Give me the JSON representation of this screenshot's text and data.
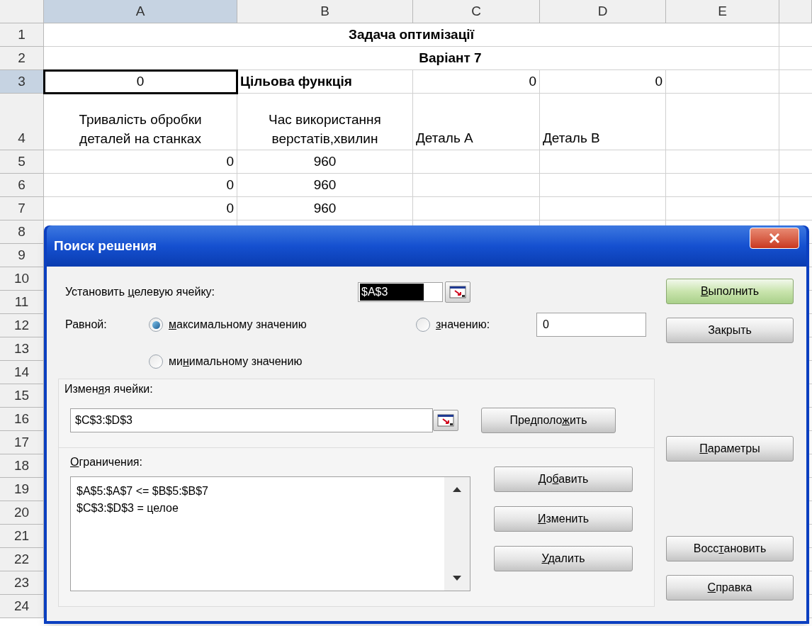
{
  "sheet": {
    "columns": [
      {
        "label": "A",
        "selected": true
      },
      {
        "label": "B",
        "selected": false
      },
      {
        "label": "C",
        "selected": false
      },
      {
        "label": "D",
        "selected": false
      },
      {
        "label": "E",
        "selected": false
      }
    ],
    "rows": [
      {
        "number": "1",
        "selected": false,
        "kind": "title",
        "text": "Задача оптимізації"
      },
      {
        "number": "2",
        "selected": false,
        "kind": "title",
        "text": "Варіант 7"
      },
      {
        "number": "3",
        "selected": true,
        "kind": "cells",
        "cells": [
          {
            "kind": "centered",
            "text": "0",
            "selected": true
          },
          {
            "kind": "heading",
            "text": "Цільова функція",
            "selected": false
          },
          {
            "kind": "number",
            "text": "0",
            "selected": false
          },
          {
            "kind": "number",
            "text": "0",
            "selected": false
          },
          {
            "kind": "empty",
            "selected": false
          }
        ]
      },
      {
        "number": "4",
        "selected": false,
        "kind": "tall",
        "cells": [
          {
            "kind": "wrapped",
            "text": "Тривалість обробки деталей на станках",
            "selected": false
          },
          {
            "kind": "wrapped",
            "text": "Час використання верстатів,хвилин",
            "selected": false
          },
          {
            "kind": "text",
            "text": "Деталь A",
            "selected": false
          },
          {
            "kind": "text",
            "text": "Деталь B",
            "selected": false
          },
          {
            "kind": "empty",
            "selected": false
          }
        ]
      },
      {
        "number": "5",
        "selected": false,
        "kind": "cells",
        "cells": [
          {
            "kind": "number",
            "text": "0",
            "selected": false
          },
          {
            "kind": "centered",
            "text": "960",
            "selected": false
          },
          {
            "kind": "empty",
            "selected": false
          },
          {
            "kind": "empty",
            "selected": false
          },
          {
            "kind": "empty",
            "selected": false
          }
        ]
      },
      {
        "number": "6",
        "selected": false,
        "kind": "cells",
        "cells": [
          {
            "kind": "number",
            "text": "0",
            "selected": false
          },
          {
            "kind": "centered",
            "text": "960",
            "selected": false
          },
          {
            "kind": "empty",
            "selected": false
          },
          {
            "kind": "empty",
            "selected": false
          },
          {
            "kind": "empty",
            "selected": false
          }
        ]
      },
      {
        "number": "7",
        "selected": false,
        "kind": "cells",
        "cells": [
          {
            "kind": "number",
            "text": "0",
            "selected": false
          },
          {
            "kind": "centered",
            "text": "960",
            "selected": false
          },
          {
            "kind": "empty",
            "selected": false
          },
          {
            "kind": "empty",
            "selected": false
          },
          {
            "kind": "empty",
            "selected": false
          }
        ]
      },
      {
        "number": "8",
        "selected": false,
        "kind": "covered"
      },
      {
        "number": "9",
        "selected": false,
        "kind": "covered"
      },
      {
        "number": "10",
        "selected": false,
        "kind": "covered"
      },
      {
        "number": "11",
        "selected": false,
        "kind": "covered"
      },
      {
        "number": "12",
        "selected": false,
        "kind": "covered"
      },
      {
        "number": "13",
        "selected": false,
        "kind": "covered"
      },
      {
        "number": "14",
        "selected": false,
        "kind": "covered"
      },
      {
        "number": "15",
        "selected": false,
        "kind": "covered"
      },
      {
        "number": "16",
        "selected": false,
        "kind": "covered"
      },
      {
        "number": "17",
        "selected": false,
        "kind": "covered"
      },
      {
        "number": "18",
        "selected": false,
        "kind": "covered"
      },
      {
        "number": "19",
        "selected": false,
        "kind": "covered"
      },
      {
        "number": "20",
        "selected": false,
        "kind": "covered"
      },
      {
        "number": "21",
        "selected": false,
        "kind": "covered"
      },
      {
        "number": "22",
        "selected": false,
        "kind": "covered"
      },
      {
        "number": "23",
        "selected": false,
        "kind": "covered"
      },
      {
        "number": "24",
        "selected": false,
        "kind": "covered"
      }
    ]
  },
  "dialog": {
    "title": "Поиск решения",
    "target": {
      "label": [
        {
          "text": "Установить ",
          "underline": false
        },
        {
          "text": "ц",
          "underline": true
        },
        {
          "text": "елевую ячейку:",
          "underline": false
        }
      ],
      "value": "$A$3",
      "value_selected": true
    },
    "equal_to": {
      "label": "Равной:",
      "options": [
        {
          "label": [
            {
              "text": "м",
              "underline": true
            },
            {
              "text": "аксимальному значению",
              "underline": false
            }
          ],
          "selected": true
        },
        {
          "label": [
            {
              "text": "з",
              "underline": true
            },
            {
              "text": "начению:",
              "underline": false
            }
          ],
          "selected": false
        },
        {
          "label": [
            {
              "text": "ми",
              "underline": false
            },
            {
              "text": "н",
              "underline": true
            },
            {
              "text": "имальному значению",
              "underline": false
            }
          ],
          "selected": false
        }
      ],
      "value": "0"
    },
    "changing": {
      "label": [
        {
          "text": "Измен",
          "underline": false
        },
        {
          "text": "я",
          "underline": true
        },
        {
          "text": "я ячейки:",
          "underline": false
        }
      ],
      "value": "$C$3:$D$3",
      "button": [
        {
          "text": "Предполо",
          "underline": false
        },
        {
          "text": "ж",
          "underline": true
        },
        {
          "text": "ить",
          "underline": false
        }
      ]
    },
    "constraints": {
      "label": [
        {
          "text": "О",
          "underline": true
        },
        {
          "text": "граничения:",
          "underline": false
        }
      ],
      "items": [
        "$A$5:$A$7 <= $B$5:$B$7",
        "$C$3:$D$3 = целое"
      ],
      "buttons": [
        [
          {
            "text": "До",
            "underline": false
          },
          {
            "text": "б",
            "underline": true
          },
          {
            "text": "авить",
            "underline": false
          }
        ],
        [
          {
            "text": "И",
            "underline": true
          },
          {
            "text": "зменить",
            "underline": false
          }
        ],
        [
          {
            "text": "У",
            "underline": true
          },
          {
            "text": "далить",
            "underline": false
          }
        ]
      ]
    },
    "side_buttons": [
      {
        "kind": "default",
        "label": [
          {
            "text": "В",
            "underline": true
          },
          {
            "text": "ыполнить",
            "underline": false
          }
        ]
      },
      {
        "kind": "normal",
        "label": [
          {
            "text": "Закрыть",
            "underline": false
          }
        ]
      },
      {
        "kind": "normal",
        "label": [
          {
            "text": "П",
            "underline": true
          },
          {
            "text": "араметры",
            "underline": false
          }
        ]
      },
      {
        "kind": "normal",
        "label": [
          {
            "text": "Восс",
            "underline": false
          },
          {
            "text": "т",
            "underline": true
          },
          {
            "text": "ановить",
            "underline": false
          }
        ]
      },
      {
        "kind": "normal",
        "label": [
          {
            "text": "С",
            "underline": true
          },
          {
            "text": "правка",
            "underline": false
          }
        ]
      }
    ]
  }
}
